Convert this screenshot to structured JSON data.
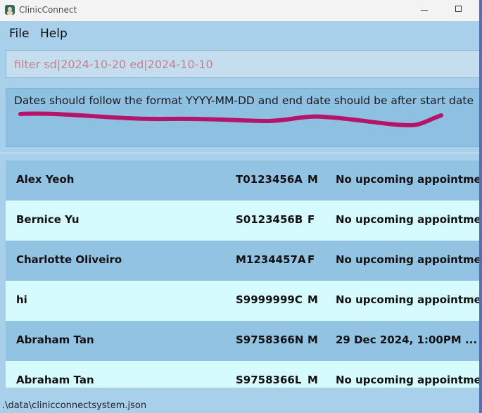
{
  "window": {
    "title": "ClinicConnect"
  },
  "menu": {
    "file": "File",
    "help": "Help"
  },
  "command": {
    "value": "filter sd|2024-10-20 ed|2024-10-10"
  },
  "result": {
    "message": "Dates should follow the format YYYY-MM-DD and end date should be after start date"
  },
  "patients": [
    {
      "name": "Alex Yeoh",
      "ic": "T0123456A",
      "sex": "M",
      "appointment": "No upcoming appointment"
    },
    {
      "name": "Bernice Yu",
      "ic": "S0123456B",
      "sex": "F",
      "appointment": "No upcoming appointment"
    },
    {
      "name": "Charlotte Oliveiro",
      "ic": "M1234457A",
      "sex": "F",
      "appointment": "No upcoming appointment"
    },
    {
      "name": "hi",
      "ic": "S9999999C",
      "sex": "M",
      "appointment": "No upcoming appointment"
    },
    {
      "name": "Abraham Tan",
      "ic": "S9758366N",
      "sex": "M",
      "appointment": "29 Dec 2024, 1:00PM   ..."
    },
    {
      "name": "Abraham Tan",
      "ic": "S9758366L",
      "sex": "M",
      "appointment": "No upcoming appointment"
    }
  ],
  "status": {
    "path": ".\\data\\clinicconnectsystem.json"
  },
  "colors": {
    "annotation": "#b5146b",
    "row_dark": "#93c3e3",
    "row_light": "#d5fbfe",
    "background": "#a8d0ea"
  }
}
